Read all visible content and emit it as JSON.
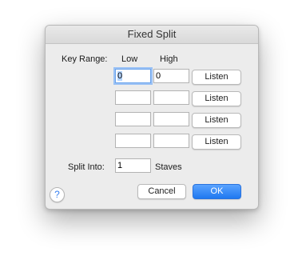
{
  "dialog": {
    "title": "Fixed Split",
    "key_range_label": "Key Range:",
    "low_header": "Low",
    "high_header": "High",
    "rows": [
      {
        "low": "0",
        "high": "0",
        "listen_label": "Listen"
      },
      {
        "low": "",
        "high": "",
        "listen_label": "Listen"
      },
      {
        "low": "",
        "high": "",
        "listen_label": "Listen"
      },
      {
        "low": "",
        "high": "",
        "listen_label": "Listen"
      }
    ],
    "split_into_label": "Split Into:",
    "split_into_value": "1",
    "staves_label": "Staves",
    "help_label": "?",
    "cancel_label": "Cancel",
    "ok_label": "OK"
  }
}
